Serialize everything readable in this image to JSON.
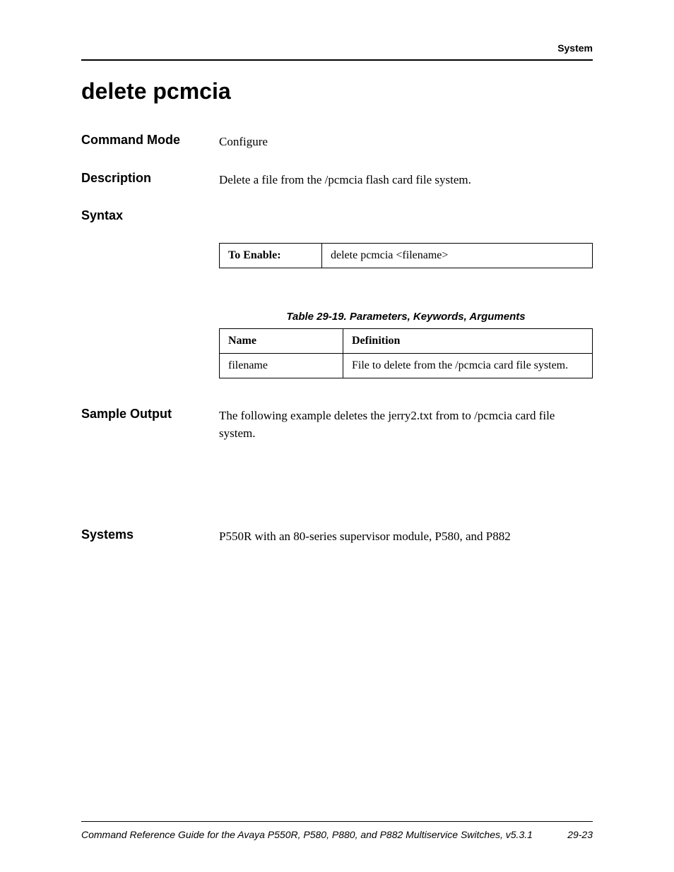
{
  "header": {
    "label": "System"
  },
  "title": "delete pcmcia",
  "sections": {
    "command_mode": {
      "heading": "Command Mode",
      "text": "Configure"
    },
    "description": {
      "heading": "Description",
      "text": "Delete a file from the /pcmcia flash card file system."
    },
    "syntax": {
      "heading": "Syntax"
    },
    "sample_output": {
      "heading": "Sample Output",
      "text": "The following example deletes the jerry2.txt from to /pcmcia card file system."
    },
    "systems": {
      "heading": "Systems",
      "text": "P550R with an 80-series supervisor module, P580, and P882"
    }
  },
  "syntax_table": {
    "label": "To Enable:",
    "value": "delete pcmcia <filename>"
  },
  "param_table": {
    "caption": "Table 29-19.  Parameters, Keywords, Arguments",
    "headers": {
      "col1": "Name",
      "col2": "Definition"
    },
    "rows": [
      {
        "name": "filename",
        "definition": "File to delete from the /pcmcia card file system."
      }
    ]
  },
  "footer": {
    "left": "Command Reference Guide for the Avaya P550R, P580, P880, and P882 Multiservice Switches, v5.3.1",
    "right": "29-23"
  }
}
